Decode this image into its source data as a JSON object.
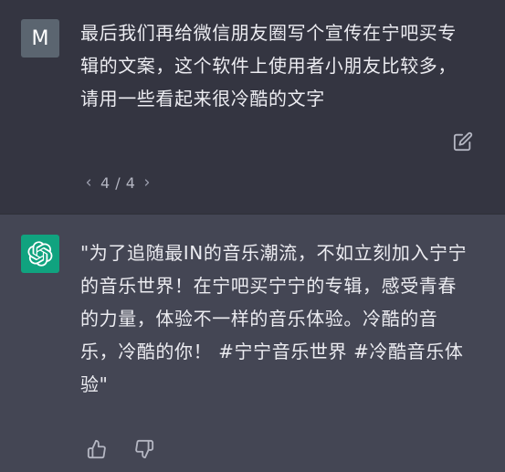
{
  "user_message": {
    "avatar_letter": "M",
    "text": "最后我们再给微信朋友圈写个宣传在宁吧买专辑的文案，这个软件上使用者小朋友比较多，请用一些看起来很冷酷的文字",
    "edit_icon": "edit-icon",
    "pager": {
      "current": "4",
      "separator": "/",
      "total": "4",
      "label": "4 / 4"
    }
  },
  "assistant_message": {
    "avatar_icon": "openai-logo-icon",
    "text": "\"为了追随最IN的音乐潮流，不如立刻加入宁宁的音乐世界！在宁吧买宁宁的专辑，感受青春的力量，体验不一样的音乐体验。冷酷的音乐，冷酷的你！ #宁宁音乐世界 #冷酷音乐体验\"",
    "feedback": {
      "like_icon": "thumbs-up-icon",
      "dislike_icon": "thumbs-down-icon"
    }
  },
  "colors": {
    "user_bg": "#343541",
    "assistant_bg": "#444654",
    "text": "#ececf1",
    "user_avatar": "#5b6570",
    "assistant_avatar": "#10a37f",
    "icon": "#b4b6c2"
  }
}
